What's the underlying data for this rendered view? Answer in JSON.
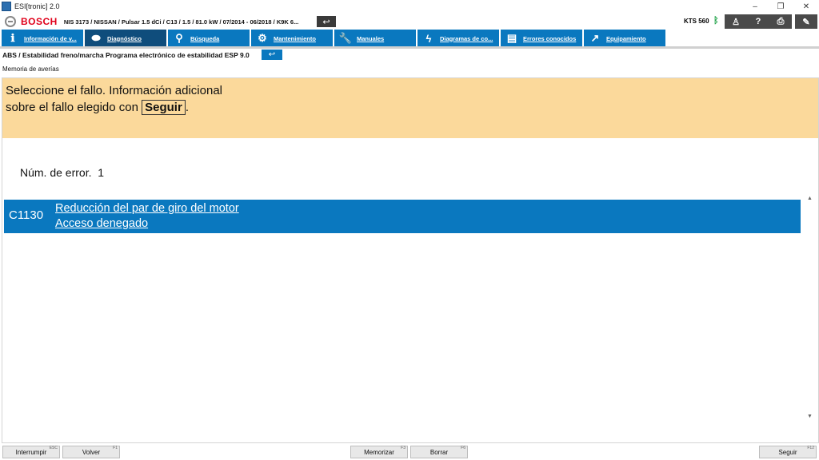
{
  "window": {
    "title": "ESI[tronic] 2.0",
    "minimize": "–",
    "restore": "❐",
    "close": "✕"
  },
  "topbar": {
    "brand": "BOSCH",
    "vehicle": "NIS 3173 / NISSAN / Pulsar 1.5 dCi / C13 / 1.5 / 81.0 kW / 07/2014 - 06/2018 / K9K 6...",
    "back": "↩",
    "device": "KTS 560",
    "bluetooth": "ᛒ",
    "buttons": {
      "user": "♙",
      "help": "?",
      "print": "⎙",
      "notes": "✎"
    }
  },
  "nav": {
    "tabs": [
      {
        "label": "Información de v...",
        "icon": "info-icon",
        "glyph": "ℹ"
      },
      {
        "label": "Diagnóstico",
        "icon": "diagnosis-icon",
        "glyph": "⬬"
      },
      {
        "label": "Búsqueda",
        "icon": "search-icon",
        "glyph": "⚲"
      },
      {
        "label": "Mantenimiento",
        "icon": "gears-icon",
        "glyph": "⚙"
      },
      {
        "label": "Manuales",
        "icon": "wrench-icon",
        "glyph": "🔧"
      },
      {
        "label": "Diagramas de co...",
        "icon": "lightning-icon",
        "glyph": "ϟ"
      },
      {
        "label": "Errores conocidos",
        "icon": "book-icon",
        "glyph": "▤"
      },
      {
        "label": "Equipamiento",
        "icon": "external-icon",
        "glyph": "↗"
      }
    ]
  },
  "breadcrumb": {
    "text": "ABS / Estabilidad freno/marcha Programa electrónico de estabilidad ESP 9.0",
    "back": "↩"
  },
  "subtitle": "Memoria de averías",
  "instruction": {
    "line1": "Seleccione el fallo. Información adicional",
    "line2_prefix": "sobre el fallo elegido con ",
    "key": "Seguir",
    "line2_suffix": "."
  },
  "error_count": {
    "label": "Núm. de error.",
    "value": "1"
  },
  "errors": [
    {
      "code": "C1130",
      "line1": "Reducción del par de giro del motor",
      "line2": "Acceso denegado"
    }
  ],
  "scroll": {
    "up": "▲",
    "down": "▼"
  },
  "footer": {
    "buttons": [
      {
        "label": "Interrumpir",
        "key": "ESC"
      },
      {
        "label": "Volver",
        "key": "F1"
      },
      {
        "label": "Memorizar",
        "key": "F3"
      },
      {
        "label": "Borrar",
        "key": "F6"
      },
      {
        "label": "Seguir",
        "key": "F12"
      }
    ]
  }
}
